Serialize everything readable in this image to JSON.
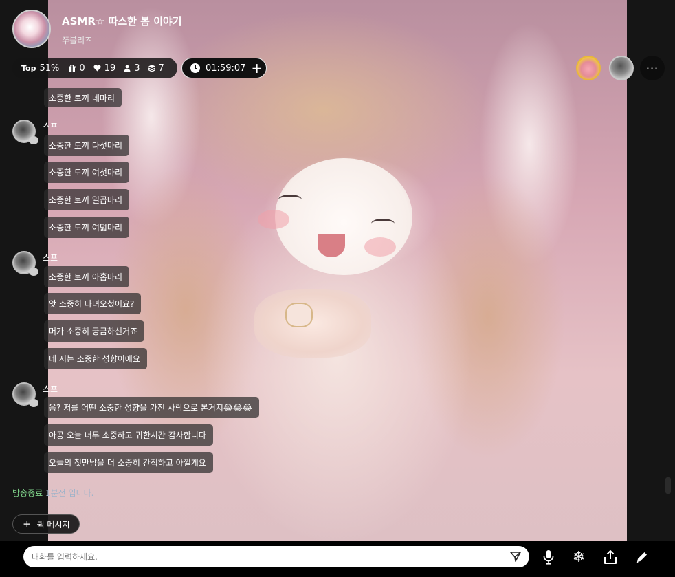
{
  "header": {
    "title": "ASMR☆ 따스한 봄 이야기",
    "subtitle": "쭈블리즈"
  },
  "stats": {
    "top_label": "Top",
    "top_percent": "51%",
    "gifts": "0",
    "likes": "19",
    "users": "3",
    "stack": "7",
    "timer": "01:59:07"
  },
  "chat": {
    "messages": [
      {
        "type": "bubble",
        "text": "소중한 토끼 네마리"
      },
      {
        "type": "name",
        "text": "스프"
      },
      {
        "type": "bubble",
        "text": "소중한 토끼 다섯마리"
      },
      {
        "type": "bubble",
        "text": "소중한 토끼 여섯마리"
      },
      {
        "type": "bubble",
        "text": "소중한 토끼 일곱마리"
      },
      {
        "type": "bubble",
        "text": "소중한 토끼 여덟마리"
      },
      {
        "type": "name",
        "text": "스프"
      },
      {
        "type": "bubble",
        "text": "소중한 토끼 아홉마리"
      },
      {
        "type": "bubble",
        "text": "앗 소중히 다녀오셨어요?"
      },
      {
        "type": "bubble",
        "text": "머가 소중히 궁금하신거죠"
      },
      {
        "type": "bubble",
        "text": "네 저는 소중한 성향이에요"
      },
      {
        "type": "name",
        "text": "스프"
      },
      {
        "type": "bubble",
        "text": "음? 저를 어떤 소중한 성향을 가진 사람으로 본거지😂😂😂"
      },
      {
        "type": "bubble",
        "text": "아공 오늘 너무 소중하고 귀한시간 감사합니다"
      },
      {
        "type": "bubble",
        "text": "오늘의 첫만남을 더 소중히 간직하고 아낄게요"
      }
    ]
  },
  "notice": {
    "highlight": "방송종료",
    "rest": " 1분전 입니다."
  },
  "quick": {
    "label": "퀵 메시지"
  },
  "input": {
    "placeholder": "대화를 입력하세요."
  },
  "icons": {
    "gift": "gift-icon",
    "heart": "heart-icon",
    "user": "user-icon",
    "stack": "stack-icon",
    "clock": "clock-icon",
    "send": "send-icon",
    "mic": "mic-icon",
    "snow": "snowflake-icon",
    "share": "share-icon",
    "pen": "pen-icon",
    "more": "more-icon"
  },
  "colors": {
    "notice_green": "#7fd38a",
    "notice_gray": "#9fb3c9",
    "bubble_bg": "#2d2d2d"
  }
}
